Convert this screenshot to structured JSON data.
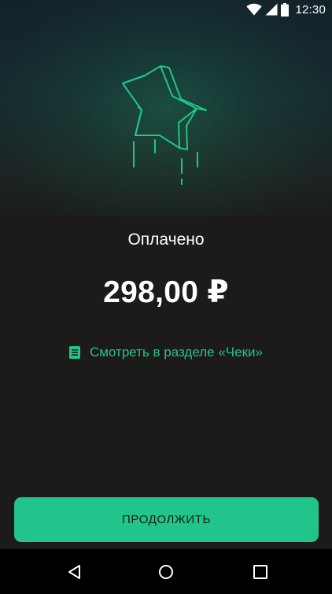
{
  "status_bar": {
    "time": "12:30",
    "icons": [
      "wifi-icon",
      "cell-signal-icon",
      "battery-icon"
    ]
  },
  "illustration": {
    "icon": "falling-star-icon"
  },
  "payment": {
    "status": "Оплачено",
    "amount": "298,00 ₽"
  },
  "receipts_link": {
    "icon": "document-icon",
    "label": "Смотреть в разделе «Чеки»"
  },
  "continue_button": {
    "label": "ПРОДОЛЖИТЬ"
  },
  "nav_bar": {
    "buttons": [
      "back-icon",
      "home-icon",
      "recent-apps-icon"
    ]
  },
  "colors": {
    "accent": "#21c48a",
    "background": "#1d1a1a",
    "nav_background": "#000000",
    "text": "#ffffff"
  }
}
